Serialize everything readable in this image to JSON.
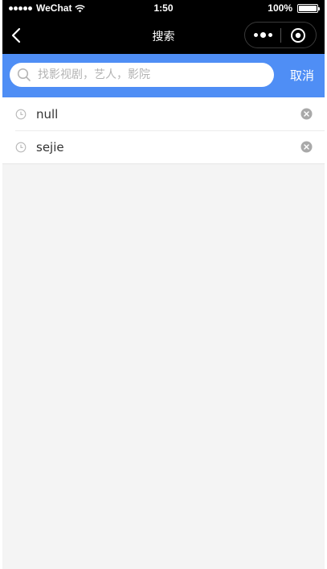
{
  "status_bar": {
    "carrier": "WeChat",
    "time": "1:50",
    "battery": "100%",
    "battery_level": 1.0
  },
  "nav": {
    "title": "搜索"
  },
  "search": {
    "placeholder": "找影视剧，艺人，影院",
    "value": "",
    "cancel_label": "取消"
  },
  "history": {
    "items": [
      {
        "text": "null"
      },
      {
        "text": "sejie"
      }
    ]
  },
  "colors": {
    "accent": "#4f8ef5",
    "nav_background": "#000000",
    "page_background": "#f4f4f4"
  }
}
